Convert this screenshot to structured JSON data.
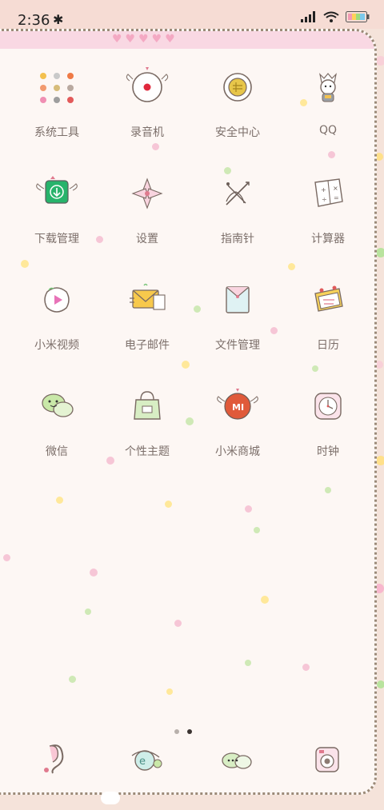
{
  "status_bar": {
    "time": "2:36",
    "bluetooth_icon": "bluetooth-icon",
    "signal_icon": "signal-icon",
    "wifi_icon": "wifi-icon",
    "battery_icon": "battery-icon"
  },
  "apps": [
    {
      "label": "系统工具",
      "icon": "tools-folder-icon"
    },
    {
      "label": "录音机",
      "icon": "recorder-icon"
    },
    {
      "label": "安全中心",
      "icon": "security-icon"
    },
    {
      "label": "QQ",
      "icon": "qq-icon"
    },
    {
      "label": "下载管理",
      "icon": "download-icon"
    },
    {
      "label": "设置",
      "icon": "settings-icon"
    },
    {
      "label": "指南针",
      "icon": "compass-icon"
    },
    {
      "label": "计算器",
      "icon": "calculator-icon"
    },
    {
      "label": "小米视频",
      "icon": "video-icon"
    },
    {
      "label": "电子邮件",
      "icon": "email-icon"
    },
    {
      "label": "文件管理",
      "icon": "file-manager-icon"
    },
    {
      "label": "日历",
      "icon": "calendar-icon"
    },
    {
      "label": "微信",
      "icon": "wechat-icon"
    },
    {
      "label": "个性主题",
      "icon": "themes-icon"
    },
    {
      "label": "小米商城",
      "icon": "mi-store-icon"
    },
    {
      "label": "时钟",
      "icon": "clock-icon"
    }
  ],
  "pager": {
    "pages": 2,
    "current": 2
  },
  "dock": [
    {
      "icon": "phone-icon"
    },
    {
      "icon": "browser-icon"
    },
    {
      "icon": "messages-icon"
    },
    {
      "icon": "camera-icon"
    }
  ],
  "colors": {
    "background": "#fdf7f4",
    "label": "#7c6f6a",
    "accent_green": "#27b36b",
    "accent_red": "#e05a3a"
  }
}
